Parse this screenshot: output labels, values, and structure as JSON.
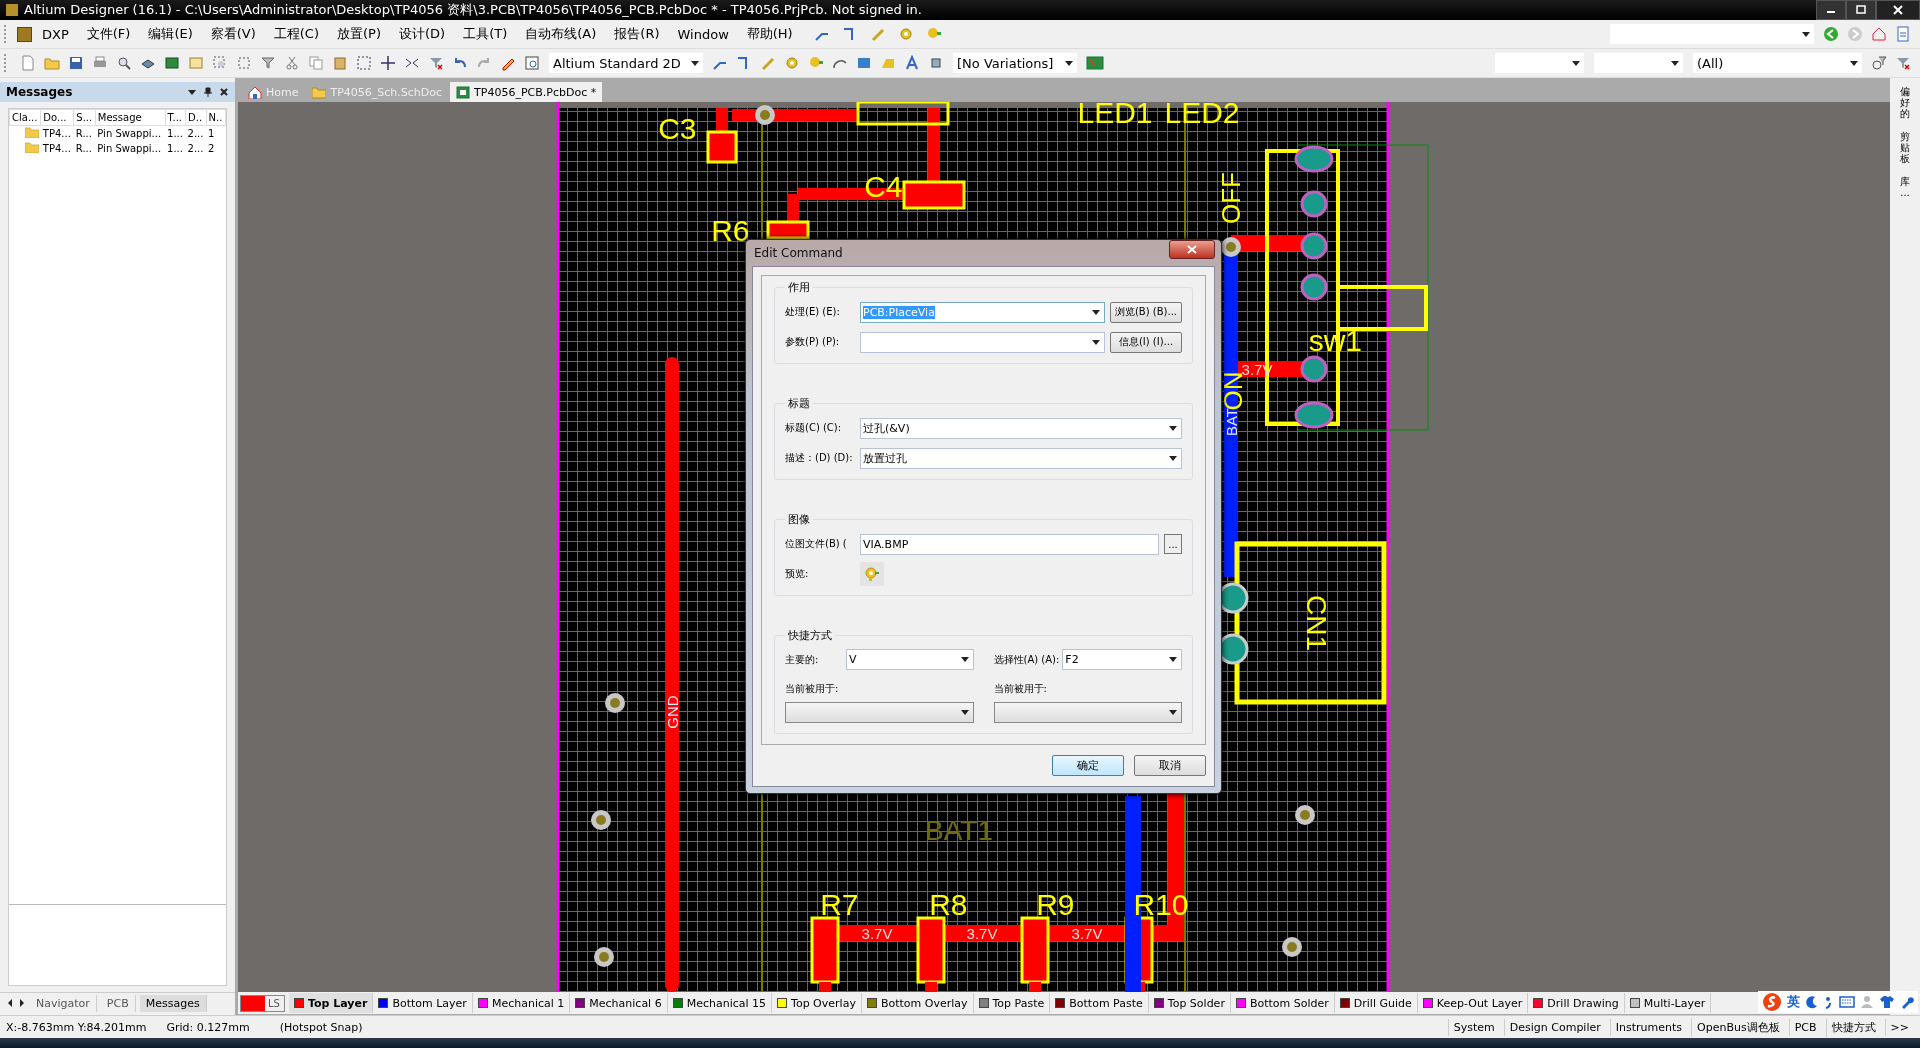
{
  "window": {
    "title": "Altium Designer (16.1) - C:\\Users\\Administrator\\Desktop\\TP4056 资料\\3.PCB\\TP4056\\TP4056_PCB.PcbDoc * - TP4056.PrjPcb. Not signed in."
  },
  "menu": [
    "DXP",
    "文件(F)",
    "编辑(E)",
    "察看(V)",
    "工程(C)",
    "放置(P)",
    "设计(D)",
    "工具(T)",
    "自动布线(A)",
    "报告(R)",
    "Window",
    "帮助(H)"
  ],
  "toolbar": {
    "view_mode": "Altium Standard 2D",
    "variations": "[No Variations]",
    "filter": "(All)"
  },
  "messages_panel": {
    "title": "Messages",
    "columns": [
      "Cla...",
      "Do...",
      "S...",
      "Message",
      "T...",
      "D..",
      "N.."
    ],
    "rows": [
      {
        "cells": [
          "",
          "TP4...",
          "R...",
          "Pin Swappi...",
          "1...",
          "2...",
          "1"
        ]
      },
      {
        "cells": [
          "",
          "TP4...",
          "R...",
          "Pin Swappi...",
          "1...",
          "2...",
          "2"
        ]
      }
    ],
    "tabs": [
      {
        "label": "Navigator",
        "selected": false
      },
      {
        "label": "PCB",
        "selected": false
      },
      {
        "label": "Messages",
        "selected": true
      }
    ]
  },
  "document_tabs": [
    {
      "label": "Home",
      "kind": "home",
      "selected": false
    },
    {
      "label": "TP4056_Sch.SchDoc",
      "kind": "schematic",
      "selected": false
    },
    {
      "label": "TP4056_PCB.PcbDoc *",
      "kind": "pcb",
      "selected": true
    }
  ],
  "canvas_labels": [
    {
      "text": "C3",
      "kind": "silk"
    },
    {
      "text": "C4",
      "kind": "silk"
    },
    {
      "text": "R6",
      "kind": "silk"
    },
    {
      "text": "LED1",
      "kind": "silk"
    },
    {
      "text": "LED2",
      "kind": "silk"
    },
    {
      "text": "OFF",
      "kind": "silk-vertical"
    },
    {
      "text": "sw1",
      "kind": "silk"
    },
    {
      "text": "3.7V",
      "kind": "net"
    },
    {
      "text": "ON",
      "kind": "silk-vertical"
    },
    {
      "text": "BAT",
      "kind": "net-vertical"
    },
    {
      "text": "CN1",
      "kind": "silk-vertical-down"
    },
    {
      "text": "GND",
      "kind": "net-vertical"
    },
    {
      "text": "BAT1",
      "kind": "bottom-overlay"
    },
    {
      "text": "R7",
      "kind": "silk"
    },
    {
      "text": "R8",
      "kind": "silk"
    },
    {
      "text": "R9",
      "kind": "silk"
    },
    {
      "text": "R10",
      "kind": "silk"
    },
    {
      "text": "3.7V",
      "kind": "net"
    },
    {
      "text": "3.7V",
      "kind": "net"
    },
    {
      "text": "3.7V",
      "kind": "net"
    }
  ],
  "dialog": {
    "title": "Edit Command",
    "action_group": {
      "label": "作用",
      "process": {
        "label": "处理(E) (E):",
        "value": "PCB:PlaceVia"
      },
      "browse_button": "浏览(B) (B)...",
      "parameters": {
        "label": "参数(P) (P):"
      },
      "info_button": "信息(I) (I)..."
    },
    "caption_group": {
      "label": "标题",
      "caption": {
        "label": "标题(C) (C):",
        "value": "过孔(&V)"
      },
      "description": {
        "label": "描述：(D) (D):",
        "value": "放置过孔"
      }
    },
    "image_group": {
      "label": "图像",
      "bitmap": {
        "label": "位图文件(B) (",
        "value": "VIA.BMP"
      },
      "browse_button": "...",
      "preview_label": "预览:"
    },
    "shortcut_group": {
      "label": "快捷方式",
      "primary": {
        "label": "主要的:",
        "value": "V"
      },
      "alternative": {
        "label": "选择性(A) (A):",
        "value": "F2"
      },
      "primary_used_label": "当前被用于:",
      "alternative_used_label": "当前被用于:"
    },
    "buttons": [
      {
        "label": "确定",
        "default": true
      },
      {
        "label": "取消",
        "default": false
      }
    ]
  },
  "side_tabs": [
    "偏好的",
    "剪贴板",
    "库..."
  ],
  "layer_bar": {
    "ls_button": "LS",
    "layers": [
      {
        "name": "Top Layer",
        "color": "#ff0000",
        "selected": true
      },
      {
        "name": "Bottom Layer",
        "color": "#0000ff",
        "selected": false
      },
      {
        "name": "Mechanical 1",
        "color": "#ff00ff",
        "selected": false
      },
      {
        "name": "Mechanical 6",
        "color": "#800080",
        "selected": false
      },
      {
        "name": "Mechanical 15",
        "color": "#008000",
        "selected": false
      },
      {
        "name": "Top Overlay",
        "color": "#ffff00",
        "selected": false
      },
      {
        "name": "Bottom Overlay",
        "color": "#808000",
        "selected": false
      },
      {
        "name": "Top Paste",
        "color": "#808080",
        "selected": false
      },
      {
        "name": "Bottom Paste",
        "color": "#800000",
        "selected": false
      },
      {
        "name": "Top Solder",
        "color": "#800080",
        "selected": false
      },
      {
        "name": "Bottom Solder",
        "color": "#ff00ff",
        "selected": false
      },
      {
        "name": "Drill Guide",
        "color": "#800000",
        "selected": false
      },
      {
        "name": "Keep-Out Layer",
        "color": "#ff00ff",
        "selected": false
      },
      {
        "name": "Drill Drawing",
        "color": "#ff002a",
        "selected": false
      },
      {
        "name": "Multi-Layer",
        "color": "#c0c0c0",
        "selected": false
      }
    ]
  },
  "ime_bar": {
    "language": "英"
  },
  "status_bar": {
    "coordinates": "X:-8.763mm Y:84.201mm",
    "grid": "Grid: 0.127mm",
    "snap": "(Hotspot Snap)",
    "panels": [
      "System",
      "Design Compiler",
      "Instruments",
      "OpenBus调色板",
      "PCB",
      "快捷方式"
    ],
    "more": ">>"
  }
}
